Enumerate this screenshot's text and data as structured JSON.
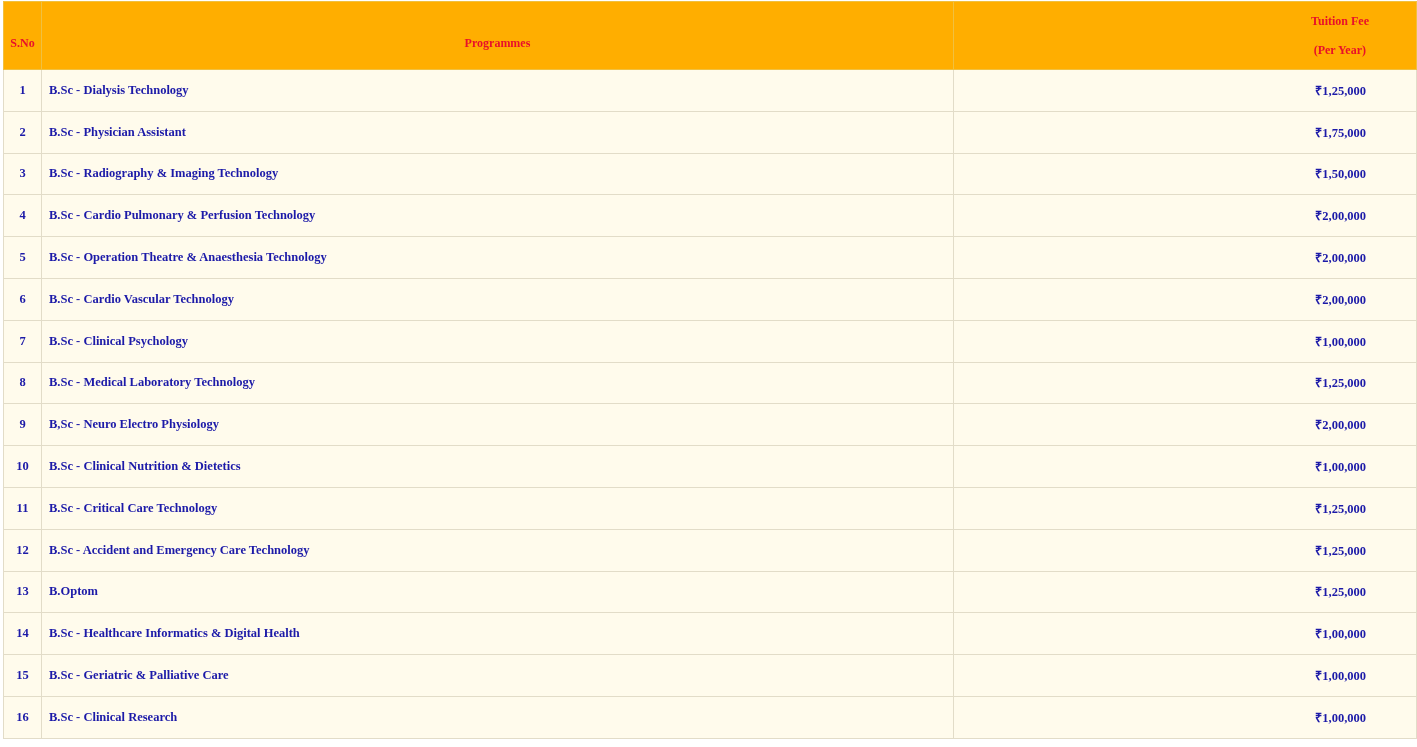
{
  "table": {
    "columns": [
      {
        "lines": [
          "S.No"
        ]
      },
      {
        "lines": [
          "Programmes"
        ]
      },
      {
        "lines": [
          "Tuition Fee",
          "(Per Year)"
        ]
      }
    ],
    "rows": [
      [
        "1",
        "B.Sc - Dialysis Technology",
        "₹1,25,000"
      ],
      [
        "2",
        "B.Sc - Physician Assistant",
        "₹1,75,000"
      ],
      [
        "3",
        "B.Sc - Radiography & Imaging Technology",
        "₹1,50,000"
      ],
      [
        "4",
        "B.Sc - Cardio Pulmonary & Perfusion Technology",
        "₹2,00,000"
      ],
      [
        "5",
        "B.Sc - Operation Theatre & Anaesthesia Technology",
        "₹2,00,000"
      ],
      [
        "6",
        "B.Sc - Cardio Vascular Technology",
        "₹2,00,000"
      ],
      [
        "7",
        "B.Sc - Clinical Psychology",
        "₹1,00,000"
      ],
      [
        "8",
        "B.Sc - Medical Laboratory Technology",
        "₹1,25,000"
      ],
      [
        "9",
        "B,Sc - Neuro Electro Physiology",
        "₹2,00,000"
      ],
      [
        "10",
        "B.Sc - Clinical Nutrition & Dietetics",
        "₹1,00,000"
      ],
      [
        "11",
        "B.Sc - Critical Care Technology",
        "₹1,25,000"
      ],
      [
        "12",
        "B.Sc - Accident and Emergency Care Technology",
        "₹1,25,000"
      ],
      [
        "13",
        "B.Optom",
        "₹1,25,000"
      ],
      [
        "14",
        "B.Sc - Healthcare Informatics & Digital Health",
        "₹1,00,000"
      ],
      [
        "15",
        "B.Sc - Geriatric & Palliative Care",
        "₹1,00,000"
      ],
      [
        "16",
        "B.Sc - Clinical Research",
        "₹1,00,000"
      ]
    ]
  }
}
